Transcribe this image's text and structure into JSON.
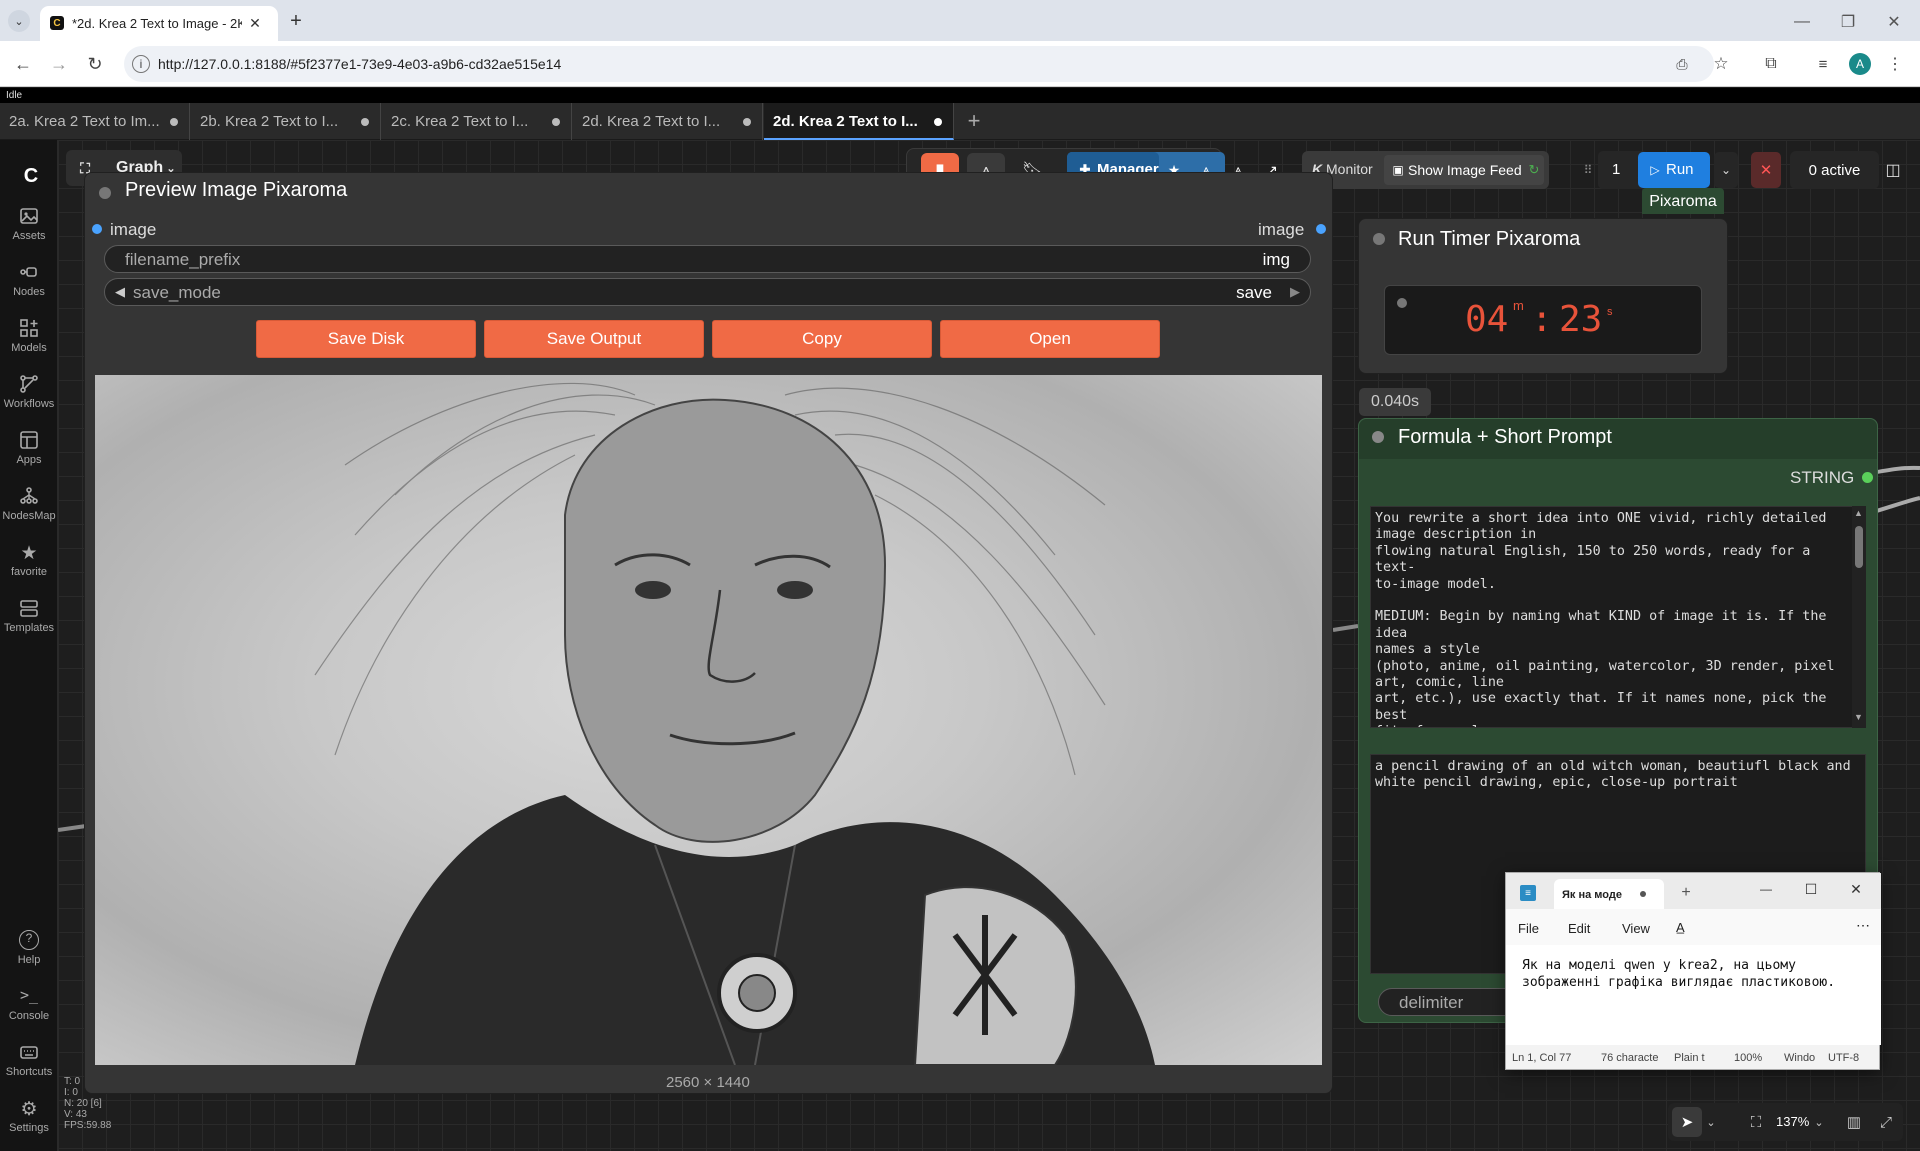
{
  "browser": {
    "tab_title": "*2d. Krea 2 Text to Image - 2K",
    "url": "http://127.0.0.1:8188/#5f2377e1-73e9-4e03-a9b6-cd32ae515e14",
    "profile_initial": "A"
  },
  "app": {
    "status": "Idle",
    "workflow_tabs": [
      {
        "label": "2a. Krea 2 Text to Im..."
      },
      {
        "label": "2b. Krea 2 Text to I..."
      },
      {
        "label": "2c. Krea 2 Text to I..."
      },
      {
        "label": "2d. Krea 2 Text to I..."
      },
      {
        "label": "2d. Krea 2 Text to I..."
      }
    ]
  },
  "sidebar": {
    "items": [
      {
        "label": "Assets",
        "icon": "image-icon"
      },
      {
        "label": "Nodes",
        "icon": "nodes-icon"
      },
      {
        "label": "Models",
        "icon": "models-icon"
      },
      {
        "label": "Workflows",
        "icon": "workflows-icon"
      },
      {
        "label": "Apps",
        "icon": "apps-icon"
      },
      {
        "label": "NodesMap",
        "icon": "nodesmap-icon"
      },
      {
        "label": "favorite",
        "icon": "star-icon"
      },
      {
        "label": "Templates",
        "icon": "templates-icon"
      },
      {
        "label": "Help",
        "icon": "help-icon"
      },
      {
        "label": "Console",
        "icon": "console-icon"
      },
      {
        "label": "Shortcuts",
        "icon": "keyboard-icon"
      },
      {
        "label": "Settings",
        "icon": "gear-icon"
      }
    ]
  },
  "toolbar": {
    "graph_label": "Graph",
    "manager_label": "Manager",
    "monitor_label": "Monitor",
    "show_feed_label": "Show Image Feed",
    "queue_count": "1",
    "run_label": "Run",
    "active_label": "0 active"
  },
  "preview_node": {
    "title": "Preview Image Pixaroma",
    "input_label": "image",
    "output_label": "image",
    "filename_prefix_label": "filename_prefix",
    "filename_prefix_value": "img",
    "save_mode_label": "save_mode",
    "save_mode_value": "save",
    "buttons": [
      "Save Disk",
      "Save Output",
      "Copy",
      "Open"
    ],
    "image_size": "2560 × 1440"
  },
  "timer_node": {
    "header_tag": "Pixaroma",
    "title": "Run Timer Pixaroma",
    "minutes": "04",
    "minutes_unit": "m",
    "seconds": "23",
    "seconds_unit": "s",
    "elapsed": "0.040s"
  },
  "formula_node": {
    "title": "Formula + Short Prompt",
    "output_label": "STRING",
    "system_prompt": "You rewrite a short idea into ONE vivid, richly detailed\nimage description in\nflowing natural English, 150 to 250 words, ready for a text-\nto-image model.\n\nMEDIUM: Begin by naming what KIND of image it is. If the idea\nnames a style\n(photo, anime, oil painting, watercolor, 3D render, pixel\nart, comic, line\nart, etc.), use exactly that. If it names none, pick the best\nfit: for real\npeople, places, objects, or any true-to-life scene, make it a\nrealistic",
    "short_prompt": "a pencil drawing of an old witch woman, beautiufl black and\nwhite pencil drawing, epic, close-up portrait",
    "delimiter_label": "delimiter"
  },
  "notepad": {
    "tab_title": "Як на моде",
    "menu": [
      "File",
      "Edit",
      "View"
    ],
    "text": "Як на моделі qwen у krea2, на цьому зображенні графіка виглядає пластиковою.",
    "status": [
      "Ln 1, Col 77",
      "76 characte",
      "Plain t",
      "100%",
      "Windo",
      "UTF-8"
    ]
  },
  "bottom_controls": {
    "zoom": "137%"
  },
  "stats": "T: 0\nI: 0\nN: 20 [6]\nV: 43\nFPS:59.88",
  "colors": {
    "accent_orange": "#f06a45",
    "run_blue": "#1f7fe0",
    "manager_blue": "#2d6ea8",
    "node_bg": "#353535",
    "formula_node_bg": "#2c4a32",
    "timer_digits": "#e8533a"
  }
}
